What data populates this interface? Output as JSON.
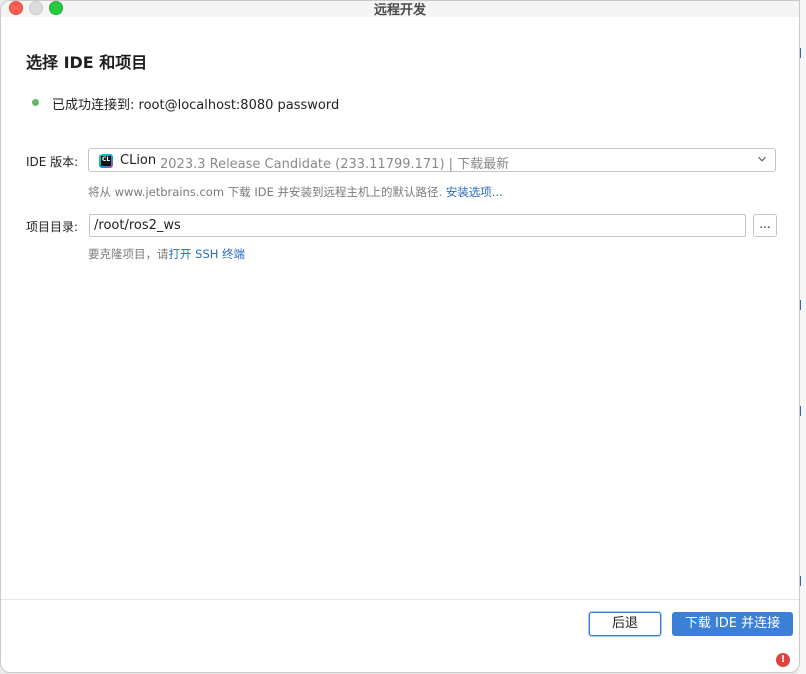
{
  "window": {
    "title": "远程开发"
  },
  "header": {
    "title": "选择 IDE 和项目"
  },
  "status": {
    "text": "已成功连接到: root@localhost:8080 password",
    "color": "#5fb865"
  },
  "ide": {
    "label": "IDE 版本:",
    "selected_name": "CLion",
    "selected_detail": "2023.3 Release Candidate (233.11799.171) | 下载最新",
    "icon": "clion-logo-icon",
    "icon_text": "CL",
    "hint_prefix": "将从 www.jetbrains.com 下载 IDE 并安装到远程主机上的默认路径.",
    "hint_link": "安装选项..."
  },
  "project": {
    "label": "项目目录:",
    "path_value": "/root/ros2_ws",
    "browse_label": "...",
    "hint_prefix": "要克隆项目，请",
    "hint_link": "打开 SSH 终端"
  },
  "footer": {
    "back_label": "后退",
    "primary_label": "下载 IDE 并连接",
    "error_badge": "!"
  },
  "colors": {
    "accent": "#3c7fd6",
    "link": "#2a6bc2",
    "error": "#e0443e"
  }
}
